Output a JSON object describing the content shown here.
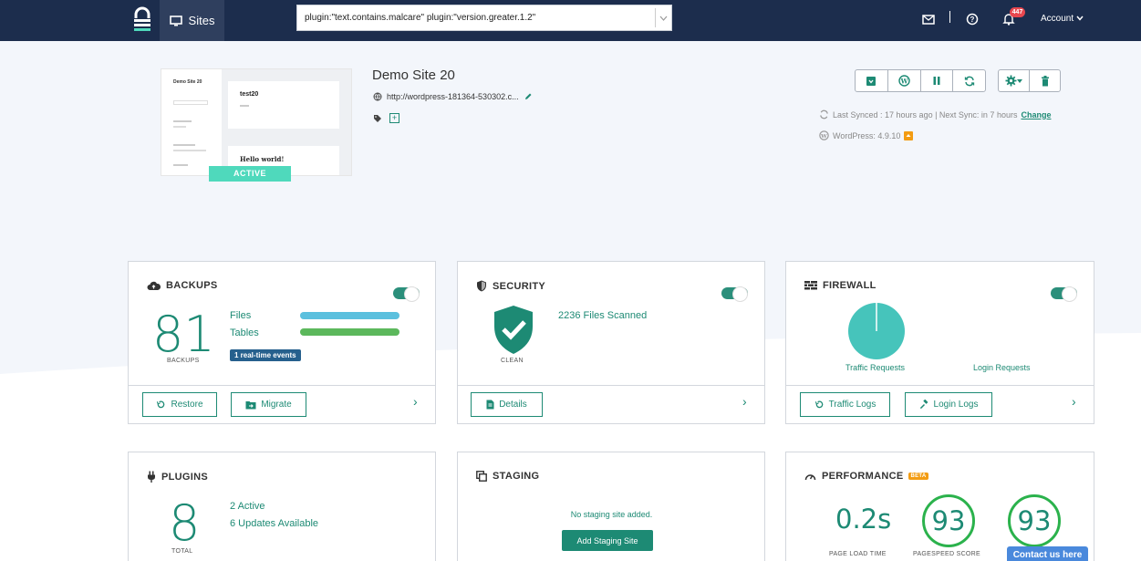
{
  "nav": {
    "sites_label": "Sites",
    "search_value": "plugin:\"text.contains.malcare\" plugin:\"version.greater.1.2\"",
    "notification_count": "447",
    "account_label": "Account"
  },
  "site": {
    "title": "Demo Site 20",
    "url": "http://wordpress-181364-530302.c...",
    "status": "ACTIVE",
    "sync_text": "Last Synced : 17 hours ago | Next Sync: in 7 hours",
    "sync_change": "Change",
    "wp_version": "WordPress: 4.9.10",
    "thumb_title": "Demo Site 20",
    "thumb_post1": "test20",
    "thumb_post2": "Hello world!"
  },
  "backups": {
    "title": "BACKUPS",
    "count": "81",
    "count_label": "BACKUPS",
    "files_label": "Files",
    "tables_label": "Tables",
    "files_progress": 1.0,
    "tables_progress": 1.0,
    "realtime_badge": "1 real-time events",
    "restore_label": "Restore",
    "migrate_label": "Migrate"
  },
  "security": {
    "title": "SECURITY",
    "status": "CLEAN",
    "scanned": "2236 Files Scanned",
    "details_label": "Details"
  },
  "firewall": {
    "title": "FIREWALL",
    "traffic_label": "Traffic Requests",
    "login_label": "Login Requests",
    "traffic_logs_label": "Traffic Logs",
    "login_logs_label": "Login Logs"
  },
  "plugins": {
    "title": "PLUGINS",
    "count": "8",
    "count_label": "TOTAL",
    "active": "2 Active",
    "updates": "6 Updates Available"
  },
  "staging": {
    "title": "STAGING",
    "empty": "No staging site added.",
    "add_label": "Add Staging Site"
  },
  "performance": {
    "title": "PERFORMANCE",
    "beta": "BETA",
    "load_time": "0.2s",
    "load_label": "PAGE LOAD TIME",
    "pagespeed": "93",
    "pagespeed_label": "PAGESPEED SCORE",
    "score2": "93"
  },
  "contact_label": "Contact us here",
  "colors": {
    "topbar": "#1c2d4d",
    "accent": "#1d8a74",
    "active": "#4fd9bc",
    "files_bar": "#5bc0de",
    "tables_bar": "#5cb85c"
  }
}
